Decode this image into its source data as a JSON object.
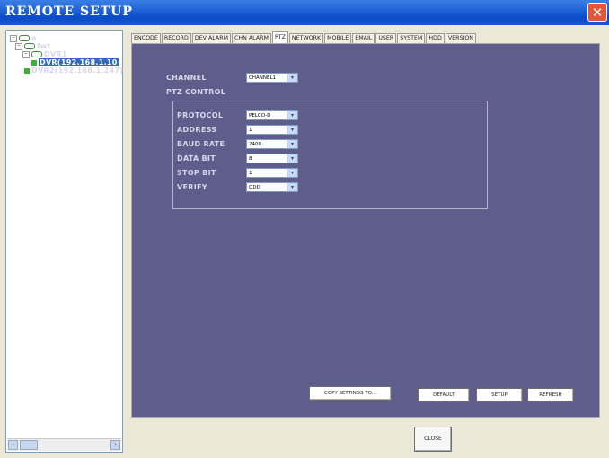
{
  "window": {
    "title": "REMOTE SETUP",
    "close_glyph": "✕"
  },
  "tree": {
    "items": [
      {
        "label": "a",
        "expander": "−"
      },
      {
        "label": "fwt",
        "expander": "−"
      },
      {
        "label": "DVR1",
        "expander": "−"
      },
      {
        "label": "DVR(192.168.1.10",
        "selected": true
      },
      {
        "label": "DVR2(192.168.1.247)"
      }
    ],
    "scroll_left": "‹",
    "scroll_right": "›"
  },
  "tabs": [
    "ENCODE",
    "RECORD",
    "DEV ALARM",
    "CHN ALARM",
    "PTZ",
    "NETWORK",
    "MOBILE",
    "EMAIL",
    "USER",
    "SYSTEM",
    "HDD",
    "VERSION"
  ],
  "active_tab": "PTZ",
  "ptz": {
    "channel_label": "CHANNEL",
    "channel_value": "CHANNEL1",
    "section_title": "PTZ CONTROL",
    "fields": [
      {
        "label": "PROTOCOL",
        "value": "PELCO-D"
      },
      {
        "label": "ADDRESS",
        "value": "1"
      },
      {
        "label": "BAUD RATE",
        "value": "2400"
      },
      {
        "label": "DATA BIT",
        "value": "8"
      },
      {
        "label": "STOP BIT",
        "value": "1"
      },
      {
        "label": "VERIFY",
        "value": "ODD"
      }
    ],
    "dropdown_glyph": "▾"
  },
  "buttons": {
    "copy_settings": "COPY SETTINGS TO...",
    "default": "DEFAULT",
    "setup": "SETUP",
    "refresh": "REFRESH",
    "close": "CLOSE"
  },
  "colors": {
    "panel_bg": "#5f5d8c",
    "titlebar": "#0b4bc7",
    "selection": "#316ac5"
  }
}
